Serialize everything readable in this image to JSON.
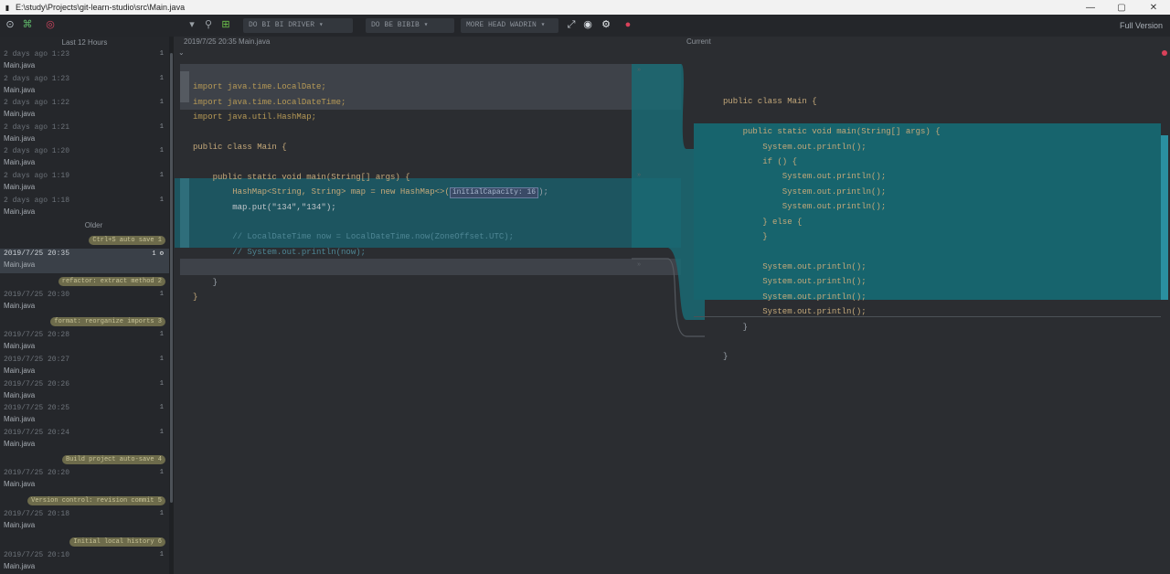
{
  "window": {
    "title": "E:\\study\\Projects\\git-learn-studio\\src\\Main.java",
    "min_glyph": "—",
    "max_glyph": "▢",
    "close_glyph": "✕"
  },
  "toolbar": {
    "branch_dropdown": "DO BI BI DRIVER ▾",
    "mode_dropdown": "DO BE BIBIB ▾",
    "view_dropdown": "MORE HEAD WADRIN ▾",
    "right_label": "Full Version"
  },
  "sidebar": {
    "header": "Last 12 Hours",
    "separator": "Older",
    "items": [
      {
        "date": "2 days ago 1:23",
        "file": "Main.java",
        "count": "1"
      },
      {
        "date": "2 days ago 1:23",
        "file": "Main.java",
        "count": "1"
      },
      {
        "date": "2 days ago 1:22",
        "file": "Main.java",
        "count": "1"
      },
      {
        "date": "2 days ago 1:21",
        "file": "Main.java",
        "count": "1"
      },
      {
        "date": "2 days ago 1:20",
        "file": "Main.java",
        "count": "1"
      },
      {
        "date": "2 days ago 1:19",
        "file": "Main.java",
        "count": "1"
      },
      {
        "date": "2 days ago 1:18",
        "file": "Main.java",
        "count": "1"
      }
    ],
    "older_items": [
      {
        "type": "tag",
        "label": "Ctrl+S auto save 1"
      },
      {
        "type": "commit",
        "date": "2019/7/25 20:35",
        "file": "Main.java",
        "count": "1 ⚙",
        "selected": true
      },
      {
        "type": "tag",
        "label": "refactor: extract method 2"
      },
      {
        "type": "commit",
        "date": "2019/7/25 20:30",
        "file": "Main.java",
        "count": "1"
      },
      {
        "type": "tag",
        "label": "format: reorganize imports 3"
      },
      {
        "type": "commit",
        "date": "2019/7/25 20:28",
        "file": "Main.java",
        "count": "1"
      },
      {
        "type": "commit",
        "date": "2019/7/25 20:27",
        "file": "Main.java",
        "count": "1"
      },
      {
        "type": "commit",
        "date": "2019/7/25 20:26",
        "file": "Main.java",
        "count": "1"
      },
      {
        "type": "commit",
        "date": "2019/7/25 20:25",
        "file": "Main.java",
        "count": "1"
      },
      {
        "type": "commit",
        "date": "2019/7/25 20:24",
        "file": "Main.java",
        "count": "1"
      },
      {
        "type": "tag",
        "label": "Build project auto-save 4"
      },
      {
        "type": "commit",
        "date": "2019/7/25 20:20",
        "file": "Main.java",
        "count": "1"
      },
      {
        "type": "tag",
        "label": "Version control: revision commit 5"
      },
      {
        "type": "commit",
        "date": "2019/7/25 20:18",
        "file": "Main.java",
        "count": "1"
      },
      {
        "type": "tag",
        "label": "Initial local history 6"
      },
      {
        "type": "commit",
        "date": "2019/7/25 20:10",
        "file": "Main.java",
        "count": "1"
      }
    ]
  },
  "left_pane": {
    "header": "2019/7/25 20:35   Main.java",
    "lines": [
      "import java.time.LocalDate;",
      "import java.time.LocalDateTime;",
      "import java.util.HashMap;",
      "",
      "public class Main {",
      "",
      "    public static void main(String[] args) {",
      "        HashMap<String, String> map = new HashMap<>(",
      "        map.put(\"134\",\"134\");",
      "",
      "        // LocalDateTime now = LocalDateTime.now(ZoneOffset.UTC);",
      "        // System.out.println(now);",
      "",
      "    }",
      "}"
    ],
    "inline_hint": "initialCapacity: 16"
  },
  "right_pane": {
    "header": "Current",
    "lines": [
      "public class Main {",
      "",
      "    public static void main(String[] args) {",
      "        System.out.println();",
      "        if () {",
      "            System.out.println();",
      "            System.out.println();",
      "            System.out.println();",
      "        } else {",
      "        }",
      "",
      "        System.out.println();",
      "        System.out.println();",
      "        System.out.println();",
      "        System.out.println();",
      "    }",
      "",
      "}"
    ]
  },
  "colors": {
    "background": "#2b2d31",
    "teal_highlight": "#15595f",
    "keyword": "#c5a97a",
    "tag_badge": "#6d6b4b"
  }
}
